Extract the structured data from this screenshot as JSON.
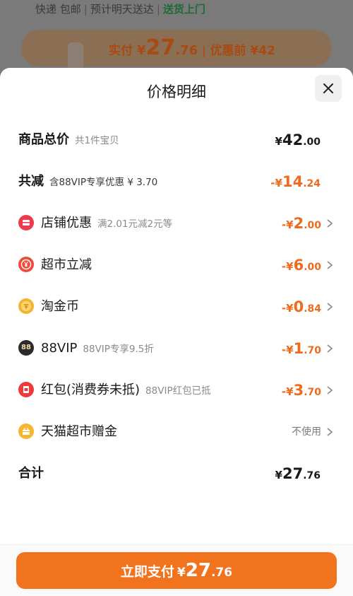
{
  "background": {
    "shipping": {
      "part1": "快递 包邮",
      "part2": "预计明天送达",
      "part3": "送货上门",
      "sep": "|"
    },
    "price": {
      "label": "实付",
      "yen": "¥",
      "int": "27",
      "dec": ".76",
      "bar": "|",
      "original": "优惠前 ¥42"
    }
  },
  "sheet": {
    "title": "价格明细",
    "close_icon": "close-icon"
  },
  "rows": {
    "total": {
      "label": "商品总价",
      "sub": "共1件宝贝",
      "sym": "¥",
      "int": "42",
      "dec": ".00"
    },
    "reduce": {
      "label": "共减",
      "sub": "含88VIP专享优惠 ¥ 3.70",
      "sym": "-¥",
      "int": "14",
      "dec": ".24"
    },
    "store": {
      "label": "店铺优惠",
      "sub": "满2.01元减2元等",
      "sym": "-¥",
      "int": "2",
      "dec": ".00",
      "icon": "store-coupon-icon"
    },
    "market": {
      "label": "超市立减",
      "sub": "",
      "sym": "-¥",
      "int": "6",
      "dec": ".00",
      "icon": "yen-circle-icon"
    },
    "coin": {
      "label": "淘金币",
      "sub": "",
      "sym": "-¥",
      "int": "0",
      "dec": ".84",
      "icon": "gold-coin-icon"
    },
    "vip": {
      "label": "88VIP",
      "sub": "88VIP专享9.5折",
      "sym": "-¥",
      "int": "1",
      "dec": ".70",
      "icon": "vip-badge-icon",
      "badge": "88"
    },
    "redpacket": {
      "label": "红包(消费券未抵)",
      "sub": "88VIP红包已抵",
      "sym": "-¥",
      "int": "3",
      "dec": ".70",
      "icon": "red-packet-icon"
    },
    "gift": {
      "label": "天猫超市赠金",
      "sub": "",
      "value": "不使用",
      "icon": "gift-icon"
    },
    "sum": {
      "label": "合计",
      "sym": "¥",
      "int": "27",
      "dec": ".76"
    }
  },
  "pay_button": {
    "label": "立即支付",
    "sym": "¥",
    "int": "27",
    "dec": ".76"
  },
  "colors": {
    "accent": "#f2731e",
    "discount": "#ee6a1c",
    "text": "#1a1a1a",
    "muted": "#8a8a8a"
  }
}
